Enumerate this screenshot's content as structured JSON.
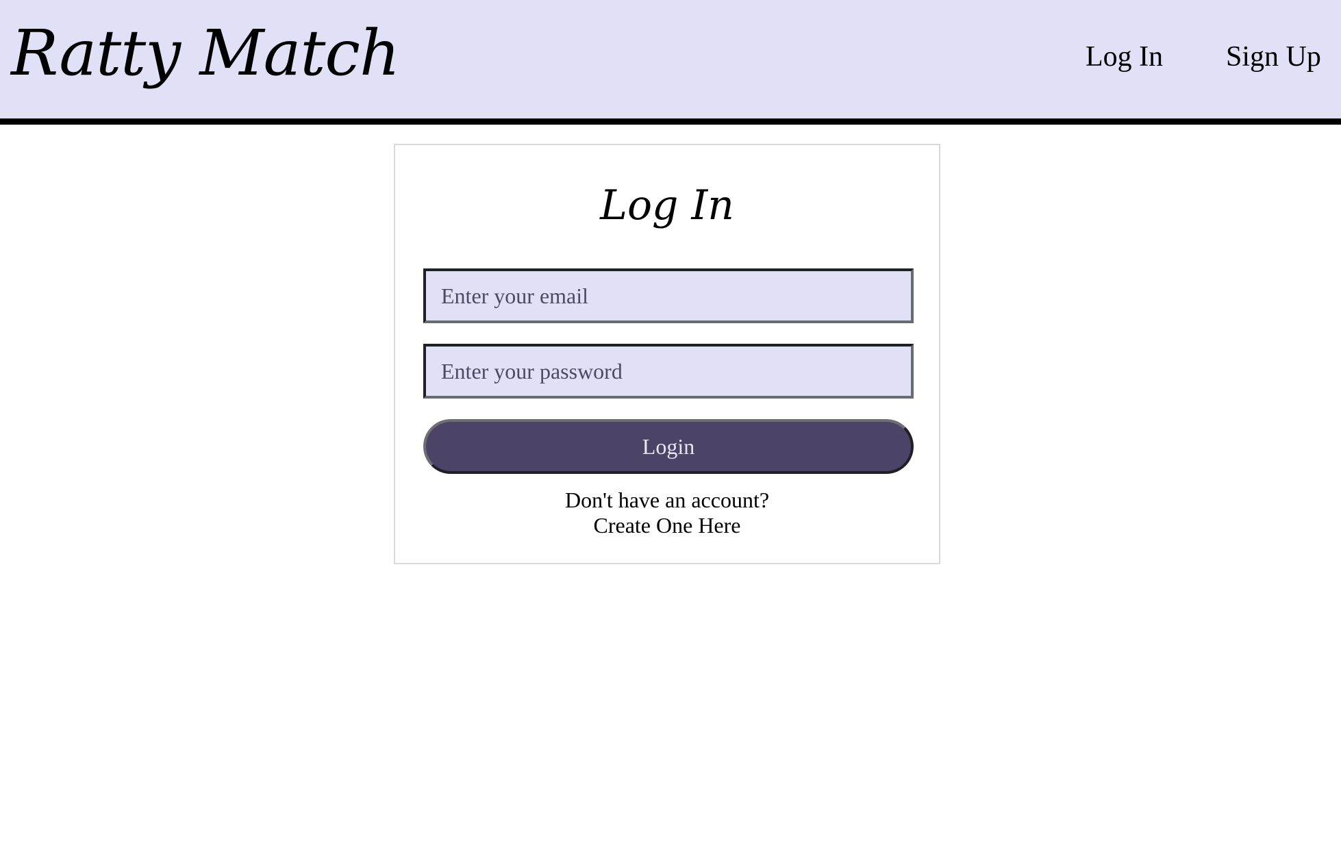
{
  "header": {
    "logo": "Ratty Match",
    "nav": {
      "login_label": "Log In",
      "signup_label": "Sign Up"
    }
  },
  "login_form": {
    "title": "Log In",
    "email_placeholder": "Enter your email",
    "password_placeholder": "Enter your password",
    "submit_label": "Login",
    "no_account_text": "Don't have an account?",
    "create_link_label": "Create One Here"
  },
  "colors": {
    "header_bg": "#e0e1f6",
    "input_bg": "#e0e1f6",
    "button_bg": "#4c4466",
    "button_text": "#e8e6f4"
  }
}
